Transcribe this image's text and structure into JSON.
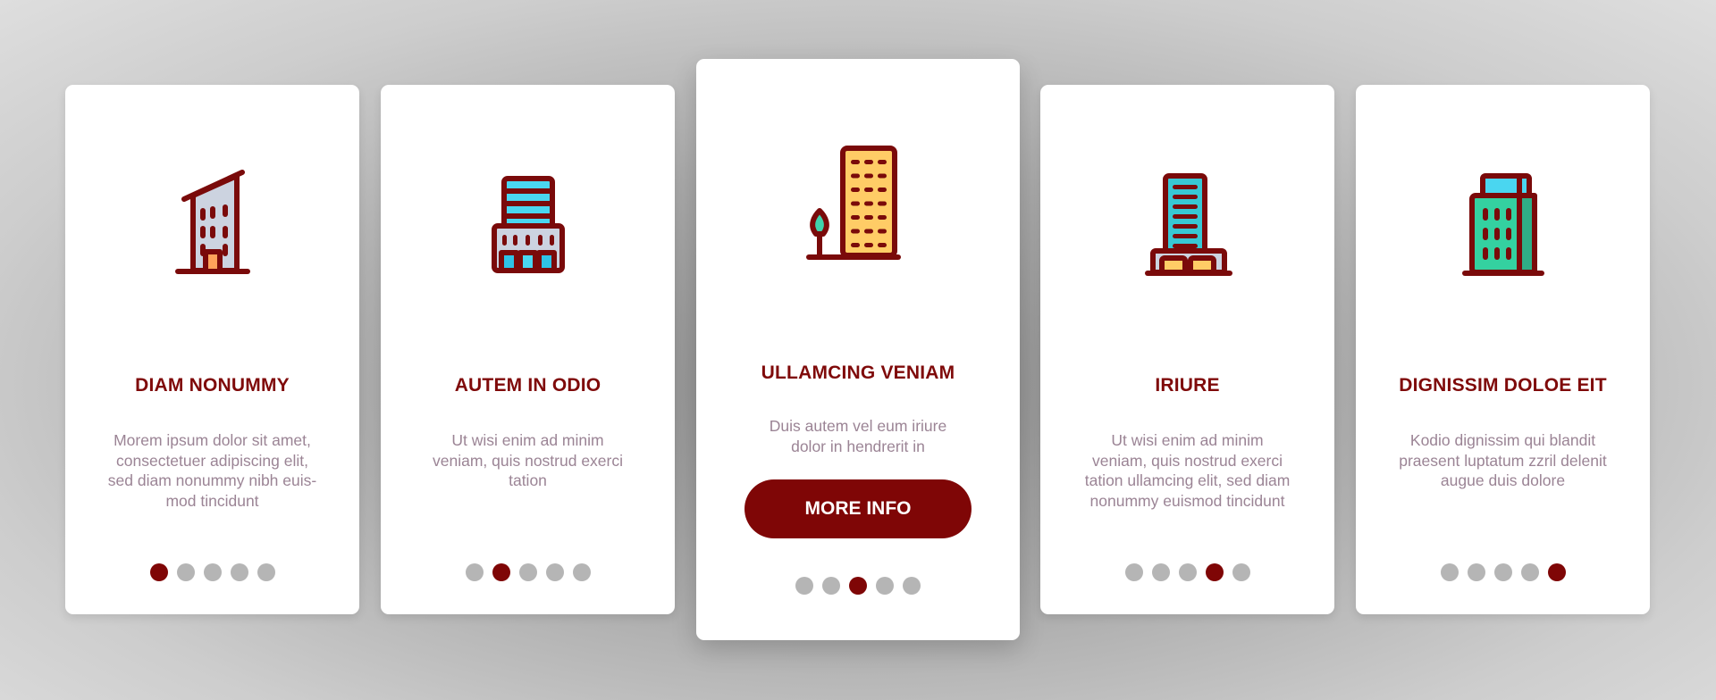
{
  "colors": {
    "accent": "#7f0606",
    "title": "#7f0a0a",
    "body_text": "#9b8495",
    "dot_inactive": "#b5b5b5",
    "background": "#b0b0b0"
  },
  "cards": [
    {
      "icon": "leaning-roof-building-icon",
      "title": "DIAM NONUMMY",
      "description": "Morem ipsum dolor sit amet, consectetuer adipiscing elit, sed diam nonummy nibh euis-mod tincidunt",
      "description_lines": [
        "Morem ipsum dolor sit amet,",
        "consectetuer adipiscing elit,",
        "sed diam nonummy nibh euis-",
        "mod tincidunt"
      ],
      "active_page": 1,
      "page_count": 5
    },
    {
      "icon": "office-tower-with-podium-icon",
      "title": "AUTEM IN ODIO",
      "description": "Ut wisi enim ad minim veniam, quis nostrud exerci tation",
      "description_lines": [
        "Ut wisi enim ad minim",
        "veniam, quis nostrud exerci",
        "tation"
      ],
      "active_page": 2,
      "page_count": 5
    },
    {
      "icon": "highrise-with-tree-icon",
      "title": "ULLAMCING VENIAM",
      "description": "Duis autem vel eum iriure dolor in hendrerit in",
      "description_lines": [
        "Duis autem vel eum iriure",
        "dolor in hendrerit in"
      ],
      "button_label": "MORE INFO",
      "active_page": 3,
      "page_count": 5
    },
    {
      "icon": "skyscraper-with-garage-icon",
      "title": "IRIURE",
      "description": "Ut wisi enim ad minim veniam, quis nostrud exerci tation ullamcing elit, sed diam nonummy euismod tincidunt",
      "description_lines": [
        "Ut wisi enim ad minim",
        "veniam, quis nostrud exerci",
        "tation ullamcing elit, sed diam",
        "nonummy euismod tincidunt"
      ],
      "active_page": 4,
      "page_count": 5
    },
    {
      "icon": "green-office-building-icon",
      "title": "DIGNISSIM DOLOE EIT",
      "description": "Kodio dignissim qui blandit praesent luptatum zzril delenit augue duis dolore",
      "description_lines": [
        "Kodio dignissim qui blandit",
        "praesent luptatum zzril delenit",
        "augue duis dolore"
      ],
      "active_page": 5,
      "page_count": 5
    }
  ]
}
